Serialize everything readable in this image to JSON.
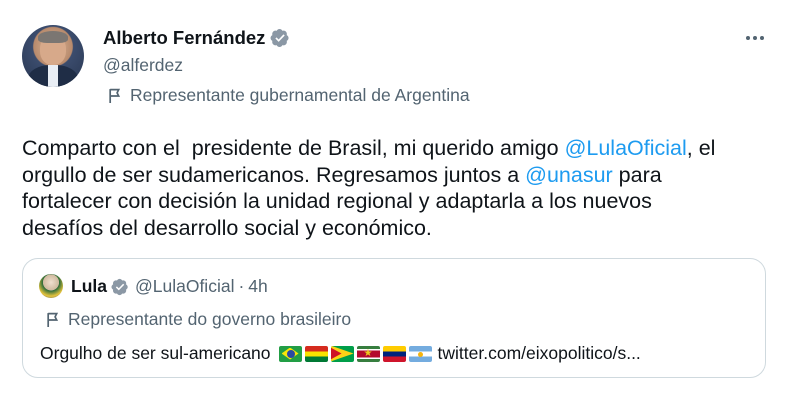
{
  "author": {
    "display_name": "Alberto Fernández",
    "handle": "@alferdez",
    "affiliation": "Representante gubernamental de Argentina",
    "verified": true,
    "verified_color": "#8b98a5"
  },
  "tweet": {
    "lines": [
      [
        "Comparto con el  presidente de Brasil, mi querido amigo ",
        "@LulaOficial",
        ", el"
      ],
      [
        "orgullo de ser sudamericanos. Regresamos juntos a ",
        "@unasur",
        " para"
      ],
      [
        "fortalecer con decisión la unidad regional y adaptarla a los nuevos"
      ],
      [
        "desafíos del desarrollo social y económico."
      ]
    ],
    "mention_color": "#1d9bf0"
  },
  "quoted": {
    "display_name": "Lula",
    "handle": "@LulaOficial",
    "separator": "·",
    "time": "4h",
    "affiliation": "Representante do governo brasileiro",
    "text": "Orgulho de ser sul-americano",
    "flags": [
      "brazil-flag-icon",
      "bolivia-flag-icon",
      "guyana-flag-icon",
      "suriname-flag-icon",
      "venezuela-flag-icon",
      "argentina-flag-icon"
    ],
    "link": "twitter.com/eixopolitico/s..."
  },
  "icons": {
    "more": "more-options-icon",
    "affiliation": "flag-outline-icon",
    "verified": "verified-badge-icon"
  }
}
